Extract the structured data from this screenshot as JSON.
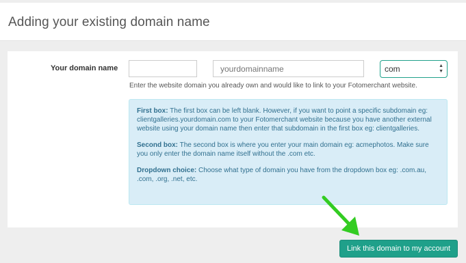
{
  "header": {
    "title": "Adding your existing domain name"
  },
  "form": {
    "label": "Your domain name",
    "subdomain_value": "",
    "domain_placeholder": "yourdomainname",
    "tld_selected": "com",
    "help": "Enter the website domain you already own and would like to link to your Fotomerchant website."
  },
  "info": {
    "first_title": "First box:",
    "first_text": " The first box can be left blank. However, if you want to point a specific subdomain eg: clientgalleries.yourdomain.com to your Fotomerchant website because you have another external website using your domain name then enter that subdomain in the first box eg: clientgalleries.",
    "second_title": "Second box:",
    "second_text": " The second box is where you enter your main domain eg: acmephotos. Make sure you only enter the domain name itself without the .com etc.",
    "dropdown_title": "Dropdown choice:",
    "dropdown_text": " Choose what type of domain you have from the dropdown box eg: .com.au, .com, .org, .net, etc."
  },
  "actions": {
    "link_label": "Link this domain to my account"
  },
  "colors": {
    "accent": "#1fa08a",
    "info_bg": "#d9edf7",
    "arrow": "#33cc22"
  }
}
